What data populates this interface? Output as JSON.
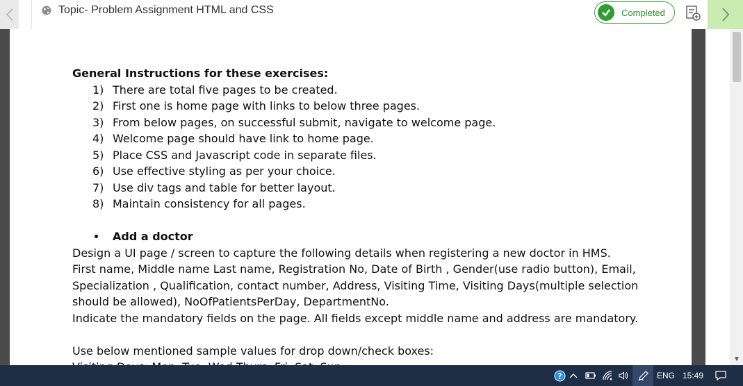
{
  "header": {
    "title": "Topic- Problem Assignment HTML and CSS",
    "status_label": "Completed",
    "colors": {
      "accent_green": "#2f9e31",
      "next_bg": "#c9ecb0"
    }
  },
  "document": {
    "heading": "General Instructions for these exercises:",
    "instructions": [
      {
        "num": "1)",
        "text": "There are total five pages to be created."
      },
      {
        "num": "2)",
        "text": "First one is home page with links to below three pages."
      },
      {
        "num": "3)",
        "text": "From below pages, on successful submit, navigate to welcome page."
      },
      {
        "num": "4)",
        "text": "Welcome page should have link to home page."
      },
      {
        "num": "5)",
        "text": "Place CSS and Javascript code in separate files."
      },
      {
        "num": "6)",
        "text": "Use effective styling as per your choice."
      },
      {
        "num": "7)",
        "text": "Use div tags and table for better layout."
      },
      {
        "num": "8)",
        "text": "Maintain consistency for all pages."
      }
    ],
    "section_bullet": "•",
    "section_title": "Add a doctor",
    "paragraph_lines": [
      "Design a UI page / screen to capture the following details when registering a new doctor  in HMS.",
      "First name, Middle name Last name,  Registration No, Date of Birth , Gender(use radio button), Email,",
      "Specialization , Qualification, contact number, Address, Visiting Time, Visiting Days(multiple selection",
      "should be allowed), NoOfPatientsPerDay, DepartmentNo.",
      "Indicate the mandatory fields on the page. All fields except middle name and address are mandatory."
    ],
    "sample_line": "Use below mentioned sample values for drop down/check boxes:",
    "partial_line": "Visiting Days:   Mon, Tue, Wed Thurs, Fri, Sat, Sun"
  },
  "taskbar": {
    "language": "ENG",
    "time": "15:49",
    "icons": [
      "help-icon",
      "chevron-up-icon",
      "battery-icon",
      "wifi-icon",
      "volume-icon",
      "pen-icon",
      "notification-icon"
    ]
  }
}
